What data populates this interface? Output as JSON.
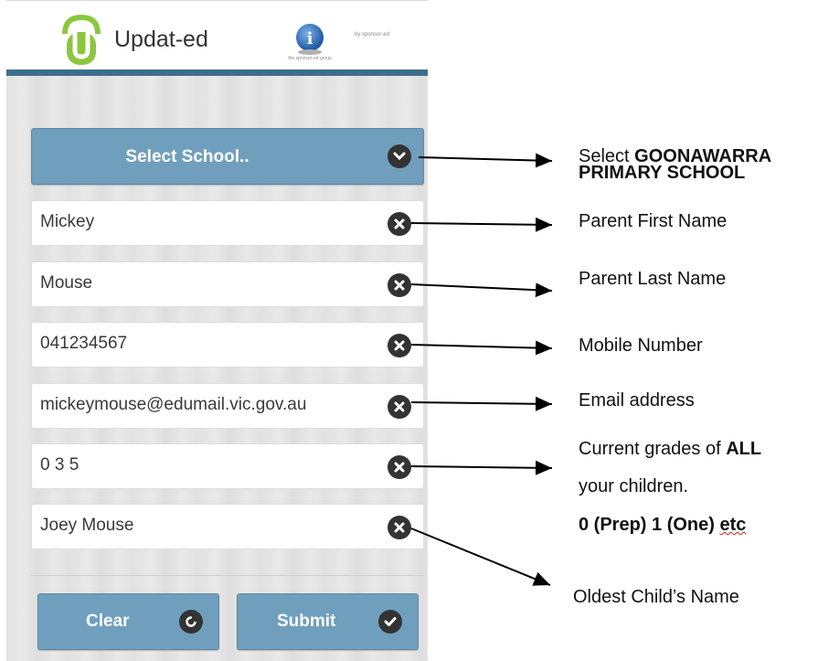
{
  "header": {
    "brand_name": "Updat-ed",
    "sponsor_subtext": "the sponsor-ed group",
    "by_sponsor": "by sponsor-ed"
  },
  "form": {
    "select_school_label": "Select School..",
    "fields": [
      {
        "value": "Mickey"
      },
      {
        "value": "Mouse"
      },
      {
        "value": "041234567"
      },
      {
        "value": "mickeymouse@edumail.vic.gov.au"
      },
      {
        "value": "0 3 5"
      },
      {
        "value": "Joey Mouse"
      }
    ],
    "clear_label": "Clear",
    "submit_label": "Submit"
  },
  "annotations": {
    "select_school_line1_prefix": "Select ",
    "select_school_line1_bold": "GOONAWARRA",
    "select_school_line2_bold": "PRIMARY SCHOOL",
    "parent_first": "Parent First Name",
    "parent_last": "Parent Last Name",
    "mobile": "Mobile Number",
    "email": "Email address",
    "grades_line1_prefix": "Current grades of ",
    "grades_line1_bold": "ALL",
    "grades_line2": "your children.",
    "grades_line3_bold": "0 (Prep) 1 (One)",
    "grades_line3_suffix": "etc",
    "oldest": "Oldest Child’s Name"
  },
  "colors": {
    "button_blue": "#6f9fbd",
    "header_bar": "#3d6f8c",
    "logo_green": "#8cc63f"
  }
}
